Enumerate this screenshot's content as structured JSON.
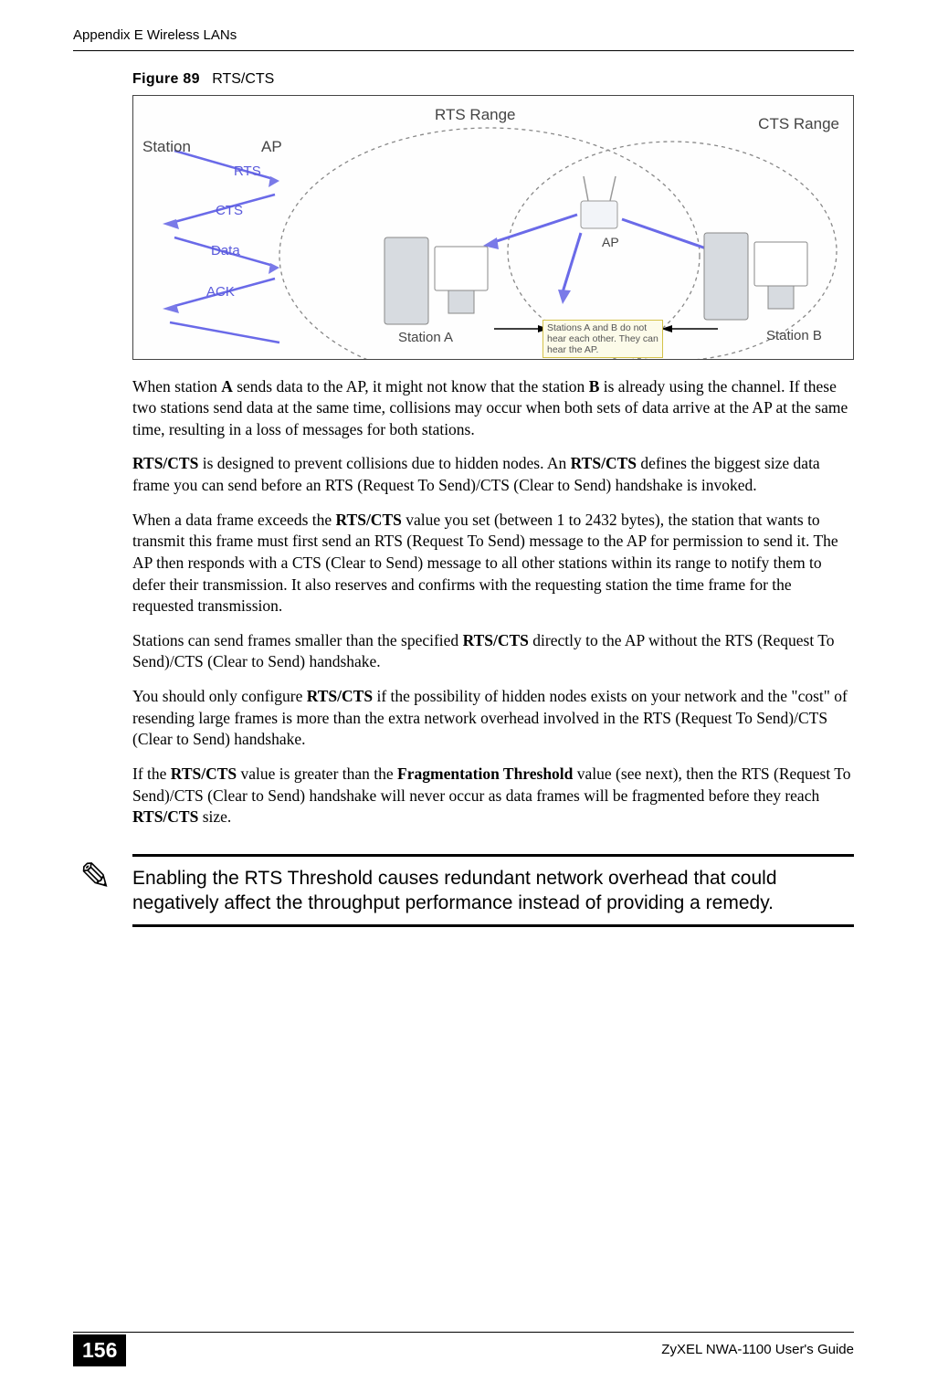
{
  "header": {
    "left": "Appendix E Wireless LANs"
  },
  "figure": {
    "label_prefix": "Figure 89",
    "label_title": "RTS/CTS",
    "rts_range": "RTS Range",
    "cts_range": "CTS Range",
    "station": "Station",
    "ap": "AP",
    "rts": "RTS",
    "cts": "CTS",
    "data": "Data",
    "ack": "ACK",
    "ap2": "AP",
    "station_a": "Station A",
    "station_b": "Station B",
    "note": "Stations A and B do not hear each other. They can hear the AP."
  },
  "paragraphs": {
    "p1_pre": "When station ",
    "p1_bold1": "A",
    "p1_mid": " sends data to the AP, it might not know that the station ",
    "p1_bold2": "B",
    "p1_post": " is already using the channel. If these two stations send data at the same time, collisions may occur when both sets of data arrive at the AP at the same time, resulting in a loss of messages for both stations.",
    "p2_bold1": "RTS/CTS",
    "p2_mid1": " is designed to prevent collisions due to hidden nodes. An ",
    "p2_bold2": "RTS/CTS",
    "p2_post": " defines the biggest size data frame you can send before an RTS (Request To Send)/CTS (Clear to Send) handshake is invoked.",
    "p3_pre": "When a data frame exceeds the ",
    "p3_bold": "RTS/CTS",
    "p3_post": " value you set (between 1 to 2432 bytes), the station that wants to transmit this frame must first send an RTS (Request To Send) message to the AP for permission to send it. The AP then responds with a CTS (Clear to Send) message to all other stations within its range to notify them to defer their transmission. It also reserves and confirms with the requesting station the time frame for the requested transmission.",
    "p4_pre": "Stations can send frames smaller than the specified ",
    "p4_bold": "RTS/CTS",
    "p4_post": " directly to the AP without the RTS (Request To Send)/CTS (Clear to Send) handshake.",
    "p5_pre": "You should only configure ",
    "p5_bold": "RTS/CTS",
    "p5_post": " if the possibility of hidden nodes exists on your network and the \"cost\" of resending large frames is more than the extra network overhead involved in the RTS (Request To Send)/CTS (Clear to Send) handshake.",
    "p6_pre": "If the ",
    "p6_bold1": "RTS/CTS",
    "p6_mid1": " value is greater than the ",
    "p6_bold2": "Fragmentation Threshold",
    "p6_mid2": " value (see next), then the RTS (Request To Send)/CTS (Clear to Send) handshake will never occur as data frames will be fragmented before they reach ",
    "p6_bold3": "RTS/CTS",
    "p6_post": " size."
  },
  "note": {
    "icon": "✎",
    "text": "Enabling the RTS Threshold causes redundant network overhead that could negatively affect the throughput performance instead of providing a remedy."
  },
  "footer": {
    "page": "156",
    "guide": "ZyXEL NWA-1100 User's Guide"
  }
}
